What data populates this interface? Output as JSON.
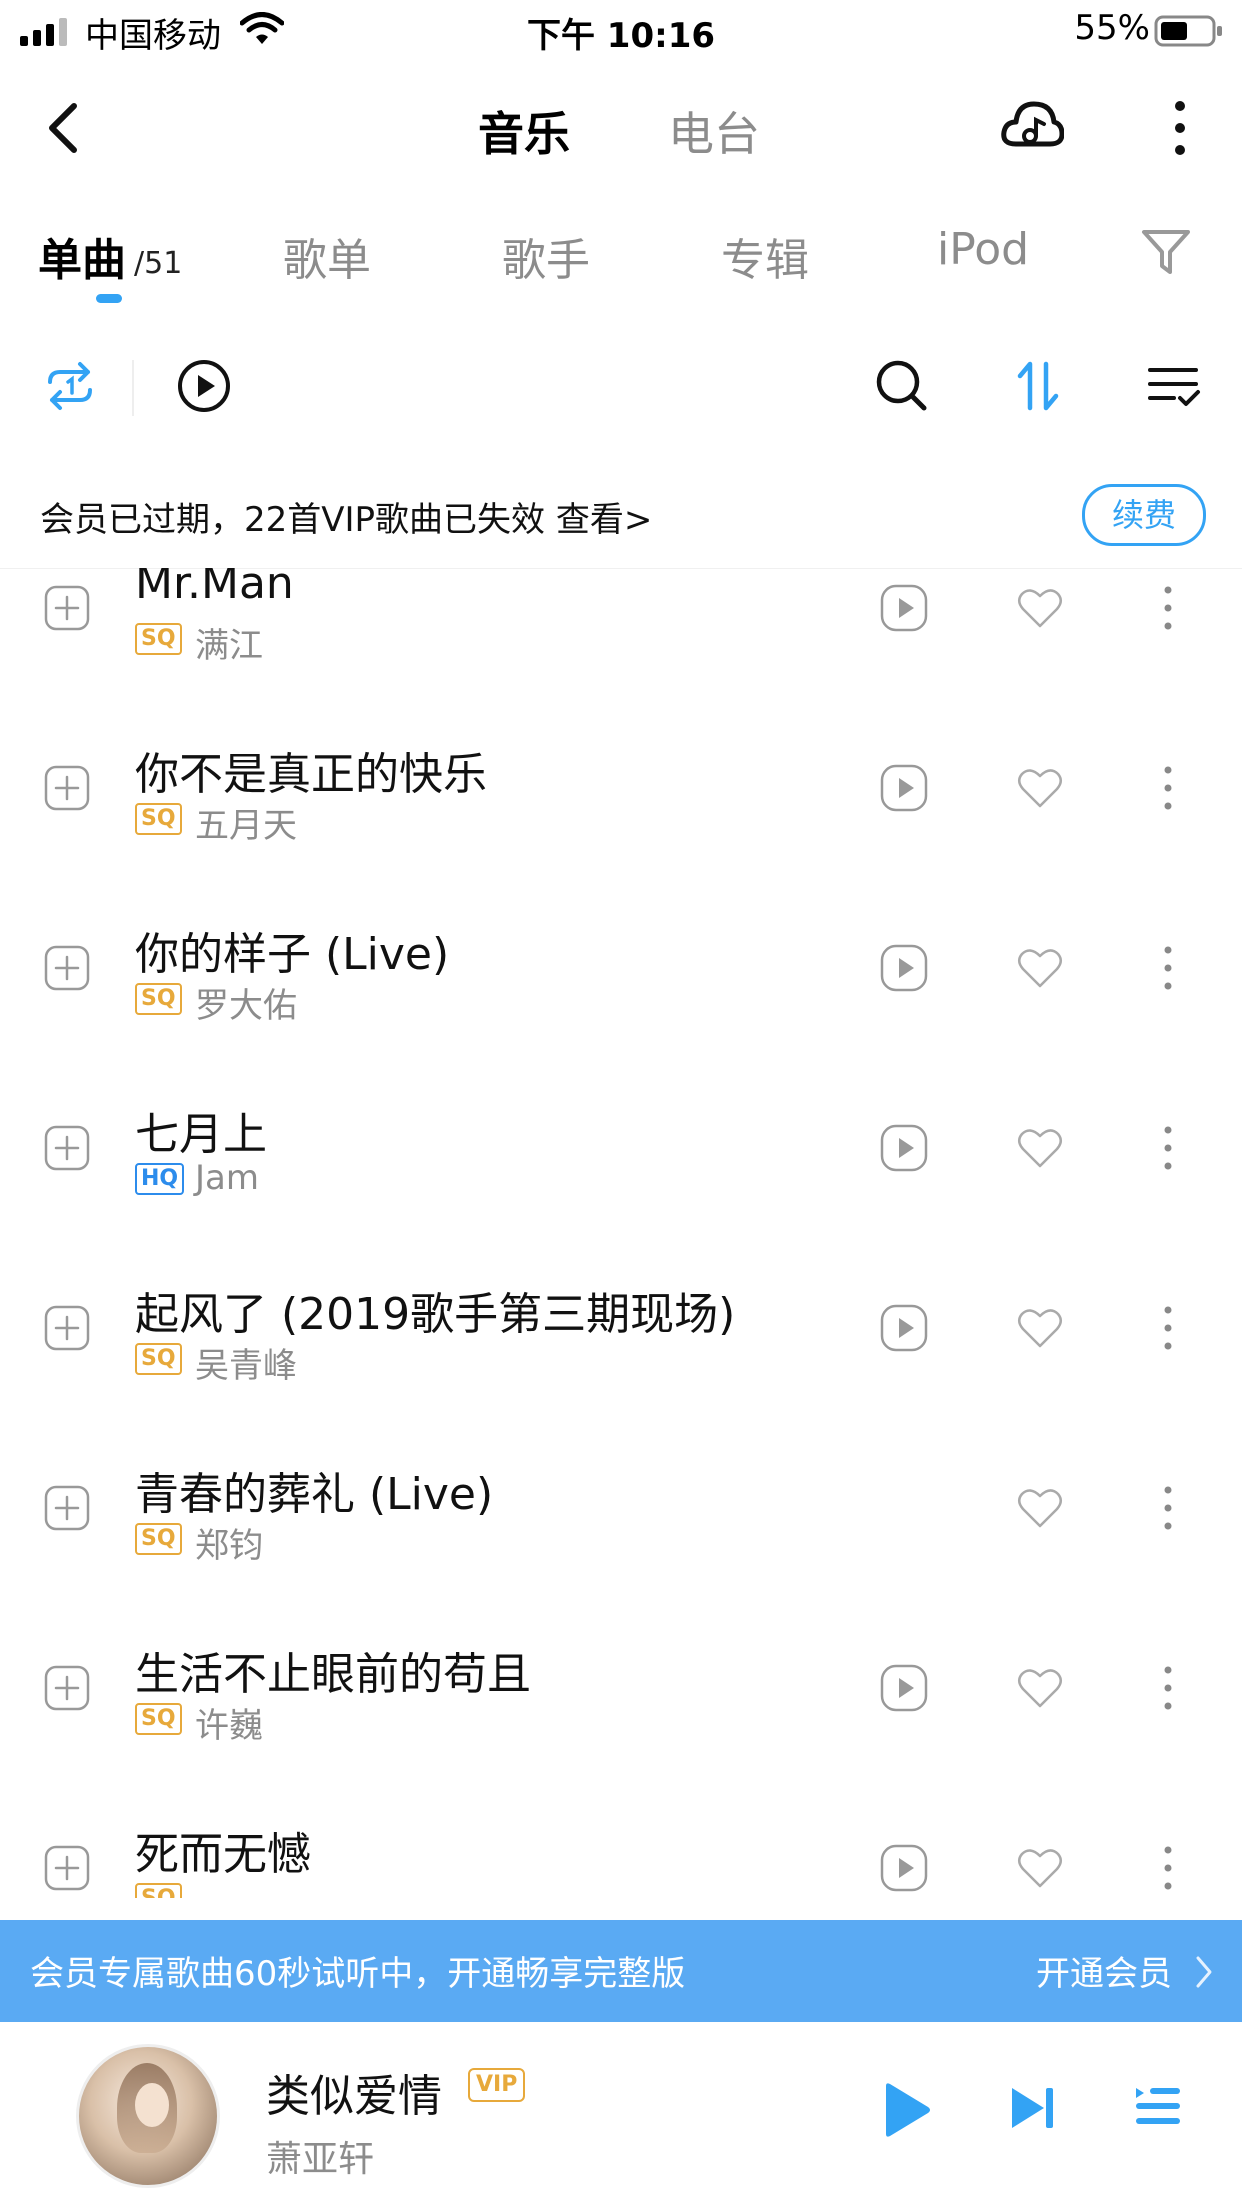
{
  "status_bar": {
    "carrier": "中国移动",
    "time": "下午 10:16",
    "battery_percent": "55%",
    "battery_level": 0.55,
    "icons": [
      "signal-icon",
      "wifi-icon",
      "battery-icon"
    ]
  },
  "nav": {
    "tabs": [
      {
        "label": "音乐",
        "active": true
      },
      {
        "label": "电台",
        "active": false
      }
    ],
    "icons": [
      "back-arrow-icon",
      "cloud-music-icon",
      "more-vertical-icon"
    ]
  },
  "categories": {
    "tabs": [
      {
        "label": "单曲",
        "active": true
      },
      {
        "label": "歌单",
        "active": false
      },
      {
        "label": "歌手",
        "active": false
      },
      {
        "label": "专辑",
        "active": false
      },
      {
        "label": "iPod",
        "active": false
      }
    ],
    "count": "/51",
    "filter_icon": "filter-icon"
  },
  "toolbar": {
    "icons": [
      "repeat-one-icon",
      "play-all-icon",
      "search-icon",
      "sort-icon",
      "manage-list-icon"
    ]
  },
  "vip_expire": {
    "message": "会员已过期，22首VIP歌曲已失效 查看>",
    "renew_label": "续费"
  },
  "songs": [
    {
      "title": "Mr.Man",
      "quality": "SQ",
      "artist": "满江",
      "playable": true
    },
    {
      "title": "你不是真正的快乐",
      "quality": "SQ",
      "artist": "五月天",
      "playable": true
    },
    {
      "title": "你的样子 (Live)",
      "quality": "SQ",
      "artist": "罗大佑",
      "playable": true
    },
    {
      "title": "七月上",
      "quality": "HQ",
      "artist": "Jam",
      "playable": true
    },
    {
      "title": "起风了 (2019歌手第三期现场)",
      "quality": "SQ",
      "artist": "吴青峰",
      "playable": true
    },
    {
      "title": "青春的葬礼 (Live)",
      "quality": "SQ",
      "artist": "郑钧",
      "playable": false
    },
    {
      "title": "生活不止眼前的苟且",
      "quality": "SQ",
      "artist": "许巍",
      "playable": true
    },
    {
      "title": "死而无憾",
      "quality": "SQ",
      "artist": "",
      "playable": true
    }
  ],
  "trial_banner": {
    "message": "会员专属歌曲60秒试听中，开通畅享完整版",
    "action": "开通会员"
  },
  "player": {
    "title": "类似爱情",
    "badge": "VIP",
    "artist": "萧亚轩",
    "icons": [
      "play-icon",
      "next-track-icon",
      "playlist-icon"
    ]
  },
  "colors": {
    "accent": "#33a3f4",
    "sq_badge": "#e7a93b",
    "hq_badge": "#2c8cec",
    "trial_banner_bg": "#5aaaf3",
    "secondary_text": "#8c8c8c"
  }
}
